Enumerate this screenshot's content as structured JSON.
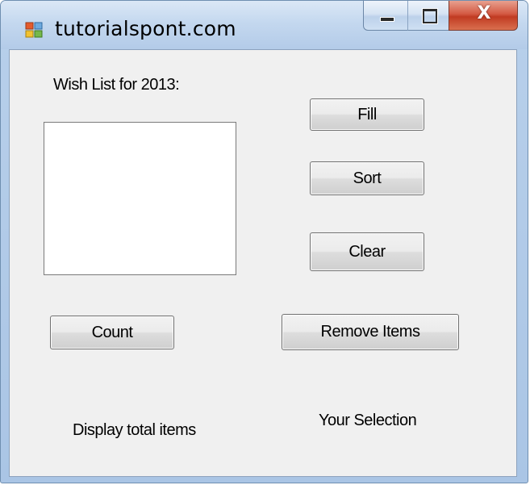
{
  "window": {
    "title": "tutorialspont.com",
    "close_glyph": "X"
  },
  "form": {
    "wishlist_label": "Wish List for 2013:",
    "buttons": {
      "fill": "Fill",
      "sort": "Sort",
      "clear": "Clear",
      "count": "Count",
      "remove_items": "Remove Items"
    },
    "display_total_label": "Display total items",
    "your_selection_label": "Your Selection",
    "listbox_items": []
  },
  "colors": {
    "titlebar": "#c4d8ef",
    "client_background": "#f0f0f0",
    "close_button": "#c13b22"
  },
  "icons": [
    "app-form-icon",
    "minimize-icon",
    "maximize-icon",
    "close-icon"
  ]
}
